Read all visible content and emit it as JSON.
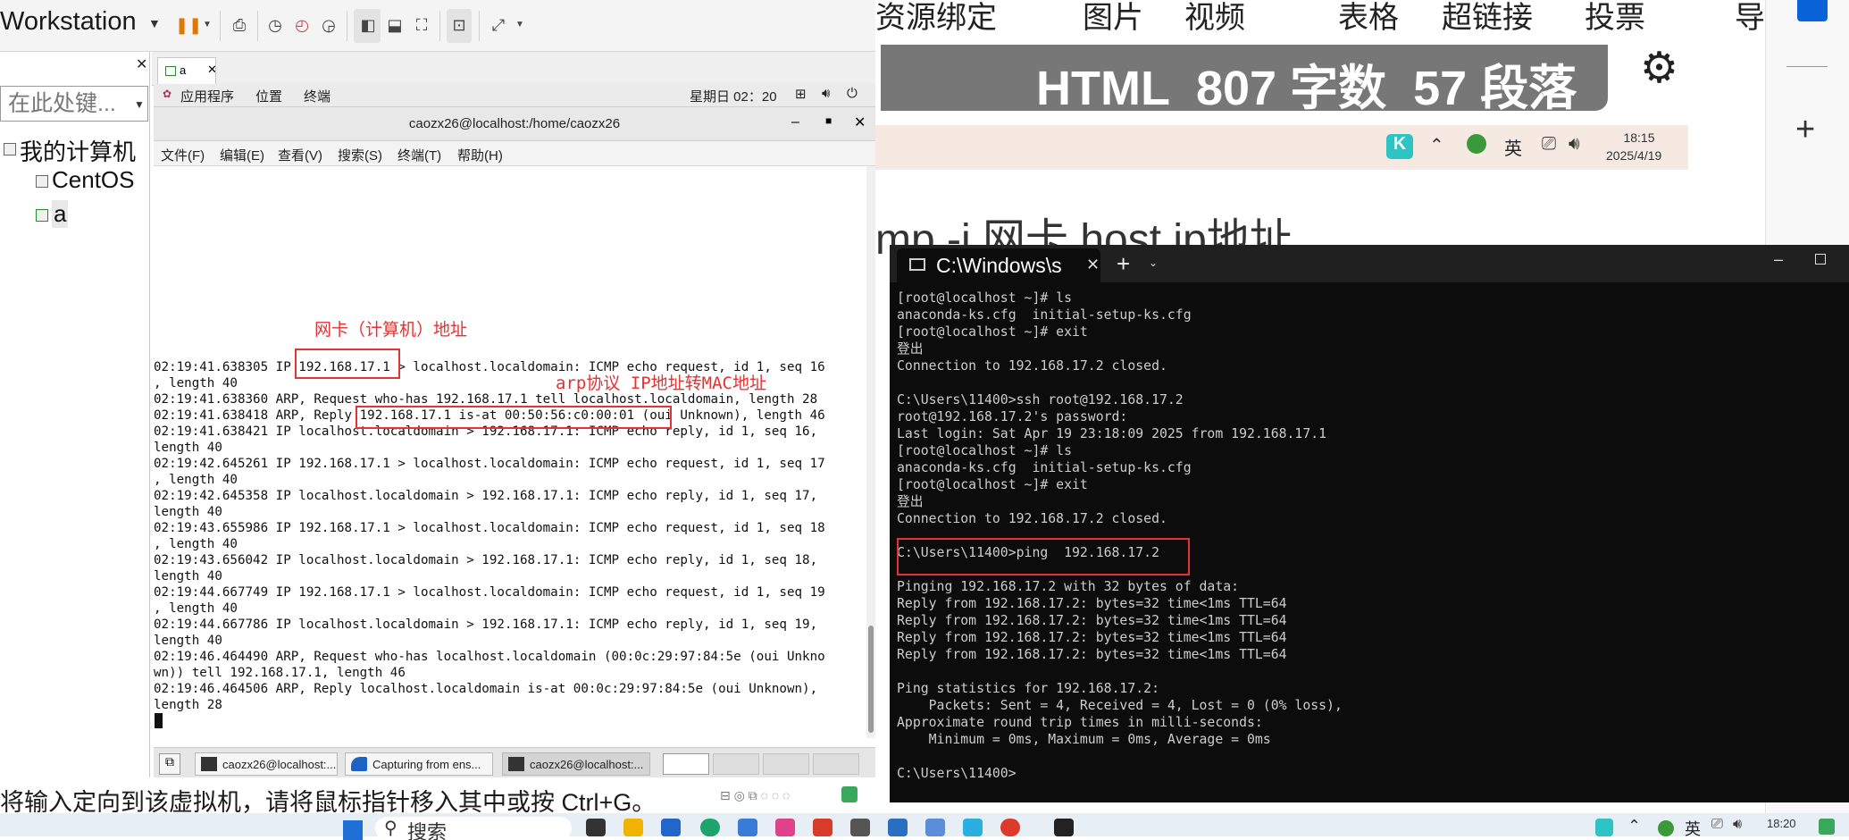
{
  "vmware": {
    "app_title": "Workstation",
    "library": {
      "search_placeholder": "在此处键...",
      "tree": [
        {
          "label": "我的计算机"
        },
        {
          "label": "CentOS"
        },
        {
          "label": "a"
        }
      ]
    },
    "vm_tab": {
      "label": "a"
    },
    "status_text": "将输入定向到该虚拟机，请将鼠标指针移入其中或按 Ctrl+G。"
  },
  "gnome": {
    "applications": "应用程序",
    "places": "位置",
    "terminal": "终端",
    "clock": "星期日 02：20"
  },
  "terminal": {
    "window_title": "caozx26@localhost:/home/caozx26",
    "menu": [
      "文件(F)",
      "编辑(E)",
      "查看(V)",
      "搜索(S)",
      "终端(T)",
      "帮助(H)"
    ],
    "lines": [
      "02:19:41.638305 IP 192.168.17.1 > localhost.localdomain: ICMP echo request, id 1, seq 16",
      ", length 40",
      "02:19:41.638360 ARP, Request who-has 192.168.17.1 tell localhost.localdomain, length 28",
      "02:19:41.638418 ARP, Reply 192.168.17.1 is-at 00:50:56:c0:00:01 (oui Unknown), length 46",
      "02:19:41.638421 IP localhost.localdomain > 192.168.17.1: ICMP echo reply, id 1, seq 16,",
      "length 40",
      "02:19:42.645261 IP 192.168.17.1 > localhost.localdomain: ICMP echo request, id 1, seq 17",
      ", length 40",
      "02:19:42.645358 IP localhost.localdomain > 192.168.17.1: ICMP echo reply, id 1, seq 17,",
      "length 40",
      "02:19:43.655986 IP 192.168.17.1 > localhost.localdomain: ICMP echo request, id 1, seq 18",
      ", length 40",
      "02:19:43.656042 IP localhost.localdomain > 192.168.17.1: ICMP echo reply, id 1, seq 18,",
      "length 40",
      "02:19:44.667749 IP 192.168.17.1 > localhost.localdomain: ICMP echo request, id 1, seq 19",
      ", length 40",
      "02:19:44.667786 IP localhost.localdomain > 192.168.17.1: ICMP echo reply, id 1, seq 19,",
      "length 40",
      "02:19:46.464490 ARP, Request who-has localhost.localdomain (00:0c:29:97:84:5e (oui Unkno",
      "wn)) tell 192.168.17.1, length 46",
      "02:19:46.464506 ARP, Reply localhost.localdomain is-at 00:0c:29:97:84:5e (oui Unknown),",
      "length 28"
    ],
    "annotations": {
      "nic_label": "网卡（计算机）地址",
      "arp_label": "arp协议 IP地址转MAC地址"
    }
  },
  "gnome_taskbar": {
    "tasks": [
      "caozx26@localhost:...",
      "Capturing from ens...",
      "caozx26@localhost:..."
    ]
  },
  "doc_editor": {
    "menu": [
      "资源绑定",
      "图片",
      "视频",
      "表格",
      "超链接",
      "投票",
      "导"
    ],
    "wordcount": "HTML  807 字数  57 段落",
    "tray": {
      "ime": "英",
      "time": "18:15",
      "date": "2025/4/19"
    },
    "body_fragment": "mp -i 网卡 host ip地址"
  },
  "win_terminal": {
    "tab_title": "C:\\Windows\\s",
    "lines": [
      "[root@localhost ~]# ls",
      "anaconda-ks.cfg  initial-setup-ks.cfg",
      "[root@localhost ~]# exit",
      "登出",
      "Connection to 192.168.17.2 closed.",
      "",
      "C:\\Users\\11400>ssh root@192.168.17.2",
      "root@192.168.17.2's password:",
      "Last login: Sat Apr 19 23:18:09 2025 from 192.168.17.1",
      "[root@localhost ~]# ls",
      "anaconda-ks.cfg  initial-setup-ks.cfg",
      "[root@localhost ~]# exit",
      "登出",
      "Connection to 192.168.17.2 closed.",
      "",
      "C:\\Users\\11400>ping  192.168.17.2",
      "",
      "Pinging 192.168.17.2 with 32 bytes of data:",
      "Reply from 192.168.17.2: bytes=32 time<1ms TTL=64",
      "Reply from 192.168.17.2: bytes=32 time<1ms TTL=64",
      "Reply from 192.168.17.2: bytes=32 time<1ms TTL=64",
      "Reply from 192.168.17.2: bytes=32 time<1ms TTL=64",
      "",
      "Ping statistics for 192.168.17.2:",
      "    Packets: Sent = 4, Received = 4, Lost = 0 (0% loss),",
      "Approximate round trip times in milli-seconds:",
      "    Minimum = 0ms, Maximum = 0ms, Average = 0ms",
      "",
      "C:\\Users\\11400>"
    ]
  },
  "win_taskbar": {
    "search_label": "搜索",
    "ime": "英",
    "time": "18:20"
  },
  "colors": {
    "annotation_red": "#e53232",
    "wt_background": "#0c0c0c",
    "wordcount_bar": "#777777"
  }
}
